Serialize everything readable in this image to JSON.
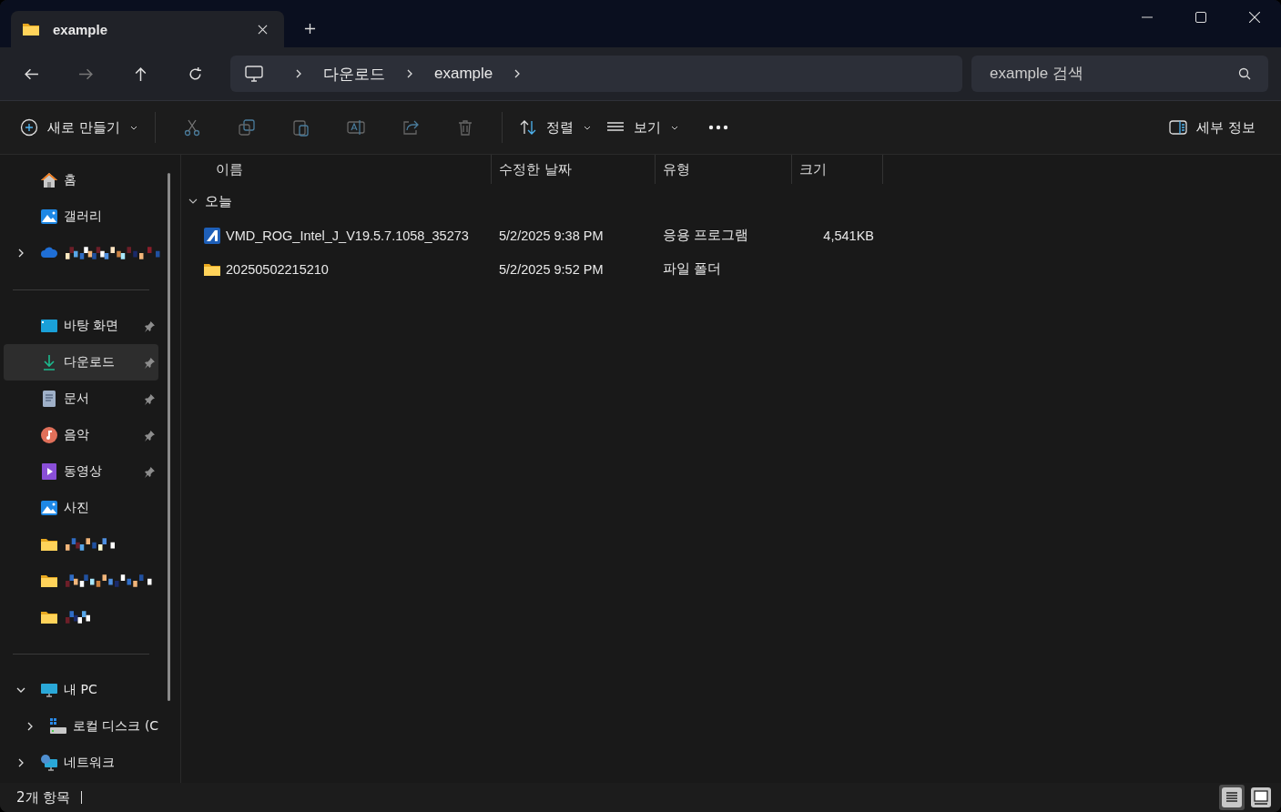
{
  "tab": {
    "title": "example",
    "selected": true
  },
  "address": {
    "crumbs": [
      "다운로드",
      "example"
    ]
  },
  "search": {
    "placeholder": "example 검색"
  },
  "toolbar": {
    "new_label": "새로 만들기",
    "sort_label": "정렬",
    "view_label": "보기",
    "details_label": "세부 정보"
  },
  "sidebar": {
    "sections": [
      [
        {
          "kind": "label",
          "label": "홈",
          "selected": false
        },
        {
          "kind": "label",
          "label": "갤러리",
          "selected": false
        },
        {
          "kind": "redacted",
          "selected": false,
          "expanded": false
        }
      ],
      [
        {
          "kind": "label",
          "label": "바탕 화면",
          "selected": false,
          "pinned": true
        },
        {
          "kind": "label",
          "label": "다운로드",
          "selected": true,
          "pinned": true
        },
        {
          "kind": "label",
          "label": "문서",
          "selected": false,
          "pinned": true
        },
        {
          "kind": "label",
          "label": "음악",
          "selected": false,
          "pinned": true
        },
        {
          "kind": "label",
          "label": "동영상",
          "selected": false,
          "pinned": true
        },
        {
          "kind": "label",
          "label": "사진",
          "selected": false,
          "pinned": false
        },
        {
          "kind": "redacted",
          "selected": false,
          "pinned": false
        },
        {
          "kind": "redacted",
          "selected": false,
          "pinned": false
        },
        {
          "kind": "redacted",
          "selected": false,
          "pinned": false
        }
      ],
      [
        {
          "kind": "label",
          "label": "내 PC",
          "selected": false,
          "expanded": true,
          "children": [
            {
              "kind": "label",
              "label": "로컬 디스크 (C",
              "selected": false,
              "expanded": false
            }
          ]
        },
        {
          "kind": "label",
          "label": "네트워크",
          "selected": false,
          "expanded": false
        }
      ]
    ]
  },
  "table": {
    "columns": [
      "이름",
      "수정한 날짜",
      "유형",
      "크기"
    ],
    "group": {
      "label": "오늘",
      "expanded": true
    },
    "rows": [
      {
        "kind": "app",
        "name": "VMD_ROG_Intel_J_V19.5.7.1058_35273",
        "date": "5/2/2025 9:38 PM",
        "type": "응용 프로그램",
        "size": "4,541KB",
        "selected": false
      },
      {
        "kind": "folder",
        "name": "20250502215210",
        "date": "5/2/2025 9:52 PM",
        "type": "파일 폴더",
        "selected": false
      }
    ]
  },
  "status_bar": {
    "count": "2개 항목",
    "details_view": true
  }
}
